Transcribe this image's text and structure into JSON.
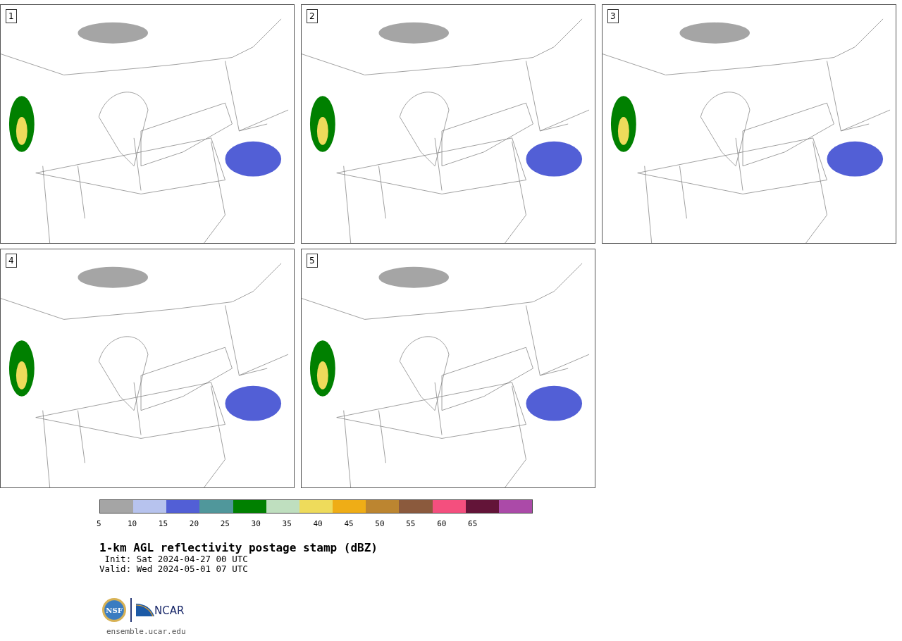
{
  "panels": [
    {
      "label": "1"
    },
    {
      "label": "2"
    },
    {
      "label": "3"
    },
    {
      "label": "4"
    },
    {
      "label": "5"
    }
  ],
  "colorbar": {
    "segments": [
      {
        "color": "#a5a5a5"
      },
      {
        "color": "#b7c3ee"
      },
      {
        "color": "#525fd6"
      },
      {
        "color": "#50979b"
      },
      {
        "color": "#008000"
      },
      {
        "color": "#bfdfbf"
      },
      {
        "color": "#eedb5b"
      },
      {
        "color": "#efad16"
      },
      {
        "color": "#bc8530"
      },
      {
        "color": "#8b5a3d"
      },
      {
        "color": "#f44f7e"
      },
      {
        "color": "#631438"
      },
      {
        "color": "#ab4aa8"
      }
    ],
    "ticks": [
      "5",
      "10",
      "15",
      "20",
      "25",
      "30",
      "35",
      "40",
      "45",
      "50",
      "55",
      "60",
      "65"
    ]
  },
  "title": "1-km AGL reflectivity postage stamp (dBZ)",
  "init": " Init: Sat 2024-04-27 00 UTC",
  "valid": "Valid: Wed 2024-05-01 07 UTC",
  "logos": {
    "nsf": "NSF",
    "ncar": "NCAR"
  },
  "url": "ensemble.ucar.edu"
}
